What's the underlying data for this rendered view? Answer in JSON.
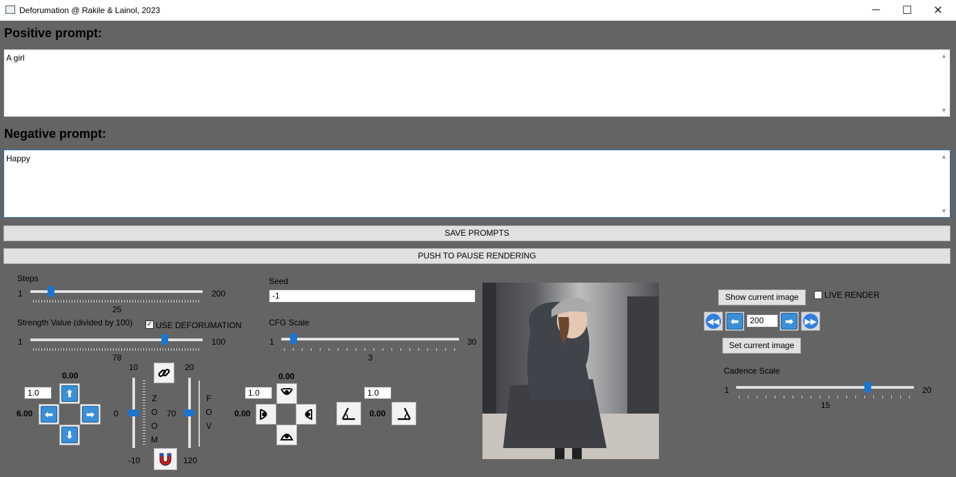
{
  "window": {
    "title": "Deforumation @ Rakile & Lainol, 2023",
    "minimize": "─",
    "maximize": "☐",
    "close": "✕"
  },
  "positive": {
    "heading": "Positive prompt:",
    "value": "A girl"
  },
  "negative": {
    "heading": "Negative prompt:",
    "value": "Happy"
  },
  "buttons": {
    "save_prompts": "SAVE PROMPTS",
    "pause_rendering": "PUSH TO PAUSE RENDERING",
    "show_current_image": "Show current image",
    "set_current_image": "Set current image"
  },
  "steps": {
    "label": "Steps",
    "min": "1",
    "max": "200",
    "value": "25",
    "fraction": 0.12
  },
  "strength": {
    "label": "Strength Value (divided by 100)",
    "min": "1",
    "max": "100",
    "value": "78",
    "fraction": 0.78,
    "use_deforumation_label": "USE DEFORUMATION",
    "use_deforumation_checked": true
  },
  "seed": {
    "label": "Seed",
    "value": "-1"
  },
  "cfg": {
    "label": "CFG Scale",
    "min": "1",
    "max": "30",
    "value": "3",
    "fraction": 0.07
  },
  "translation": {
    "step_value": "1.0",
    "y_value": "0.00",
    "x_value": "6.00"
  },
  "zoom": {
    "letters": [
      "Z",
      "O",
      "O",
      "M"
    ],
    "top": "10",
    "middle": "0",
    "bottom": "-10",
    "fraction": 0.5
  },
  "fov": {
    "letters": [
      "F",
      "O",
      "V"
    ],
    "top": "20",
    "middle": "70",
    "bottom": "120",
    "fraction": 0.5
  },
  "rotation": {
    "step_value": "1.0",
    "y_value": "0.00",
    "x_value": "0.00"
  },
  "tilt": {
    "step_value": "1.0",
    "value": "0.00"
  },
  "live_render": {
    "label": "LIVE RENDER",
    "checked": false
  },
  "frame_nav": {
    "value": "200"
  },
  "cadence": {
    "label": "Cadence Scale",
    "min": "1",
    "max": "20",
    "value": "15",
    "fraction": 0.74
  },
  "icons": {
    "link": "link-icon",
    "magnet": "magnet-icon"
  }
}
